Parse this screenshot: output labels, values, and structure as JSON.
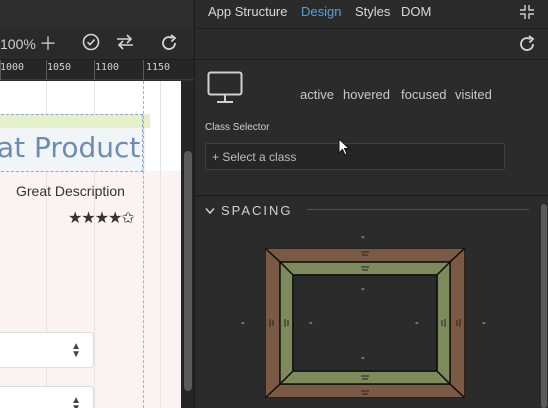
{
  "toolbar": {
    "zoom": "100%",
    "icons": [
      "plus-icon",
      "check-circle-icon",
      "swap-icon",
      "refresh-icon"
    ]
  },
  "ruler": {
    "ticks": [
      "1000",
      "1050",
      "1100",
      "1150"
    ]
  },
  "canvas": {
    "product_title": "at Product",
    "description": "Great Description",
    "stars": "★★★★✩",
    "select_arrow": "▴▾"
  },
  "panel": {
    "tabs": [
      "App Structure",
      "Design",
      "Styles",
      "DOM"
    ],
    "active_tab": "Design",
    "states": [
      "active",
      "hovered",
      "focused",
      "visited"
    ],
    "class_selector_label": "Class Selector",
    "class_placeholder": "+ Select a class",
    "spacing_title": "SPACING",
    "spacing_dash": "-",
    "colors": {
      "accent": "#5a9fe0",
      "margin": "#7a5a45",
      "padding": "#7d8a5c"
    }
  }
}
